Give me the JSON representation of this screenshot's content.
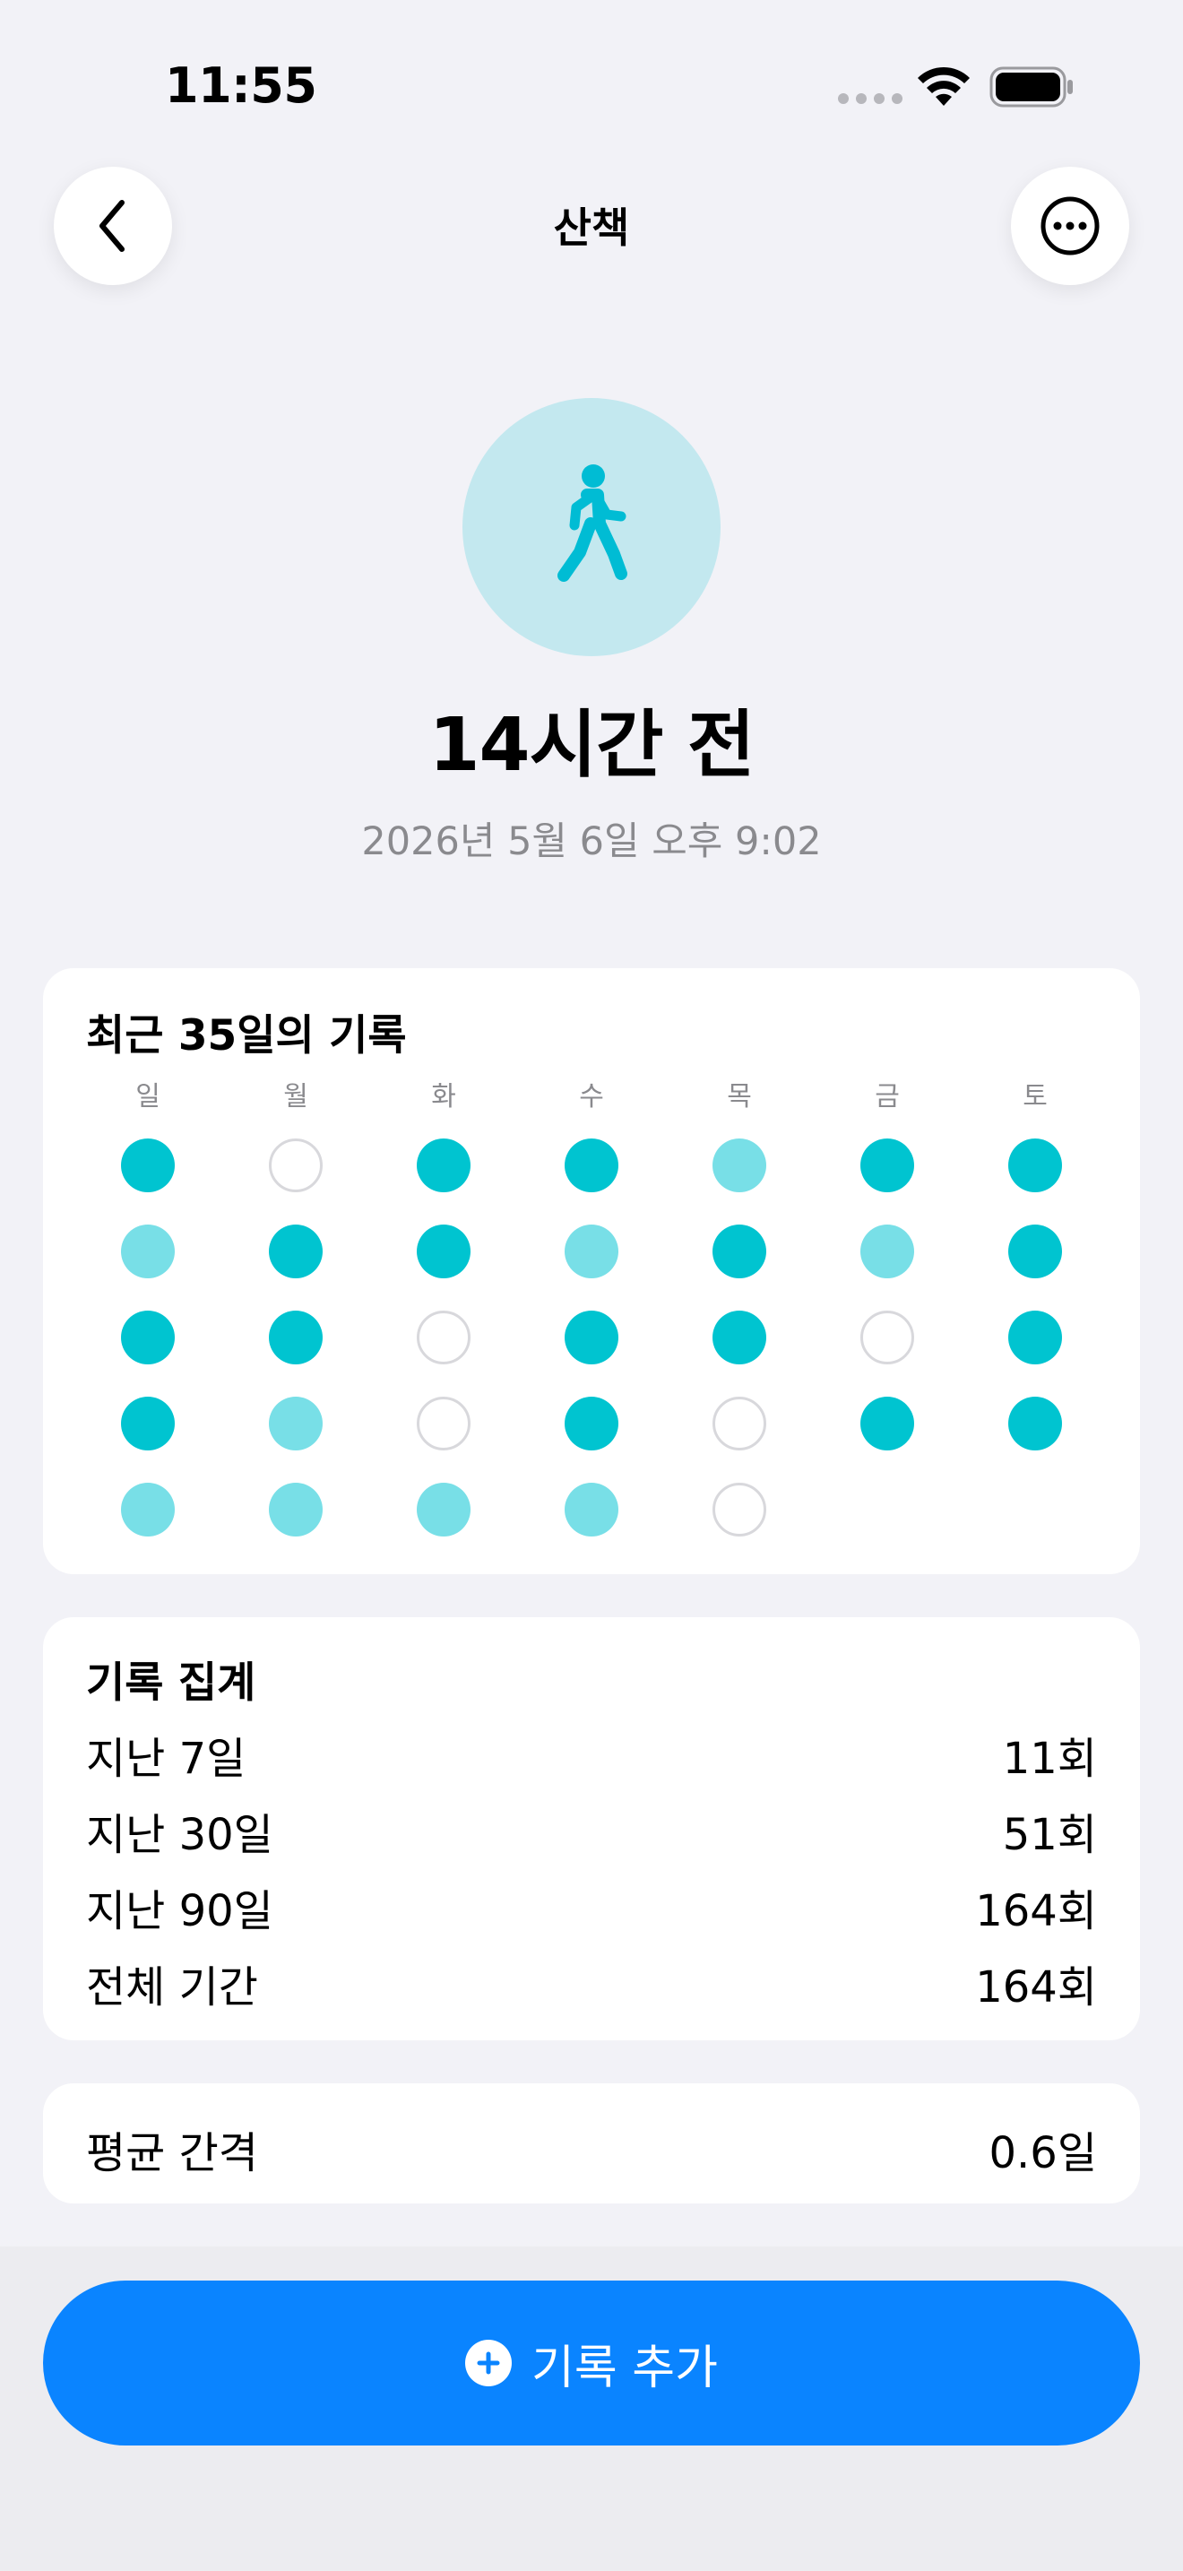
{
  "status_bar": {
    "time": "11:55"
  },
  "nav": {
    "title": "산책",
    "back_icon": "chevron-left-icon",
    "more_icon": "ellipsis-circle-icon"
  },
  "hero": {
    "icon": "walking-person-icon",
    "icon_bg_color": "#c3e8ef",
    "icon_color": "#00bcd4",
    "headline": "14시간 전",
    "subline": "2026년 5월 6일 오후 9:02"
  },
  "history": {
    "title": "최근 35일의 기록",
    "weekdays": [
      "일",
      "월",
      "화",
      "수",
      "목",
      "금",
      "토"
    ],
    "legend_colors": {
      "full": "#00c4d0",
      "light": "#78dfe7",
      "empty": "#ffffff"
    },
    "rows": [
      [
        "full",
        "empty",
        "full",
        "full",
        "light",
        "full",
        "full"
      ],
      [
        "light",
        "full",
        "full",
        "light",
        "full",
        "light",
        "full"
      ],
      [
        "full",
        "full",
        "empty",
        "full",
        "full",
        "empty",
        "full"
      ],
      [
        "full",
        "light",
        "empty",
        "full",
        "empty",
        "full",
        "full"
      ],
      [
        "light",
        "light",
        "light",
        "light",
        "empty"
      ]
    ]
  },
  "stats": {
    "title": "기록 집계",
    "rows": [
      {
        "label": "지난 7일",
        "value": "11회"
      },
      {
        "label": "지난 30일",
        "value": "51회"
      },
      {
        "label": "지난 90일",
        "value": "164회"
      },
      {
        "label": "전체 기간",
        "value": "164회"
      }
    ]
  },
  "average": {
    "label": "평균 간격",
    "value": "0.6일"
  },
  "add_button": {
    "label": "기록 추가",
    "icon": "plus-circle-icon",
    "color": "#0a84ff"
  }
}
